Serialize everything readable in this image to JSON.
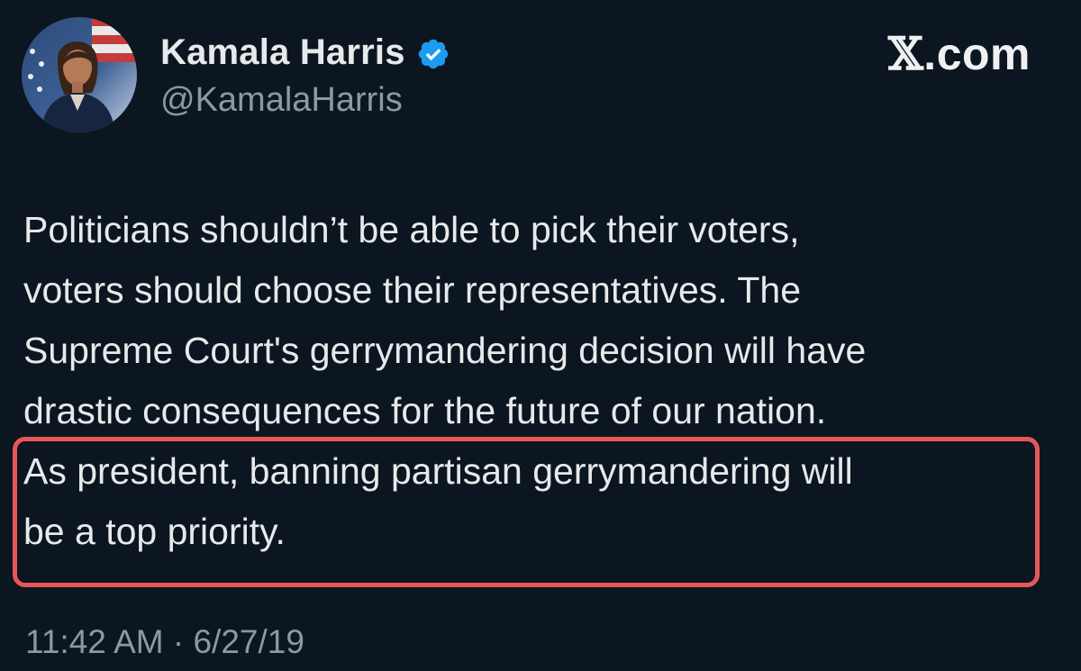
{
  "author": {
    "display_name": "Kamala Harris",
    "handle": "@KamalaHarris",
    "verified": true,
    "avatar_icon": "profile-photo"
  },
  "brand": {
    "x_glyph": "𝕏",
    "domain": ".com"
  },
  "tweet": {
    "text_before_highlight": "Politicians shouldn’t be able to pick their voters,\nvoters should choose their representatives. The\nSupreme Court's gerrymandering decision will have\ndrastic consequences for the future of our nation.",
    "highlighted_text": "As president, banning partisan gerrymandering will\nbe a top priority.",
    "timestamp": "11:42 AM · 6/27/19"
  },
  "colors": {
    "background": "#0c1620",
    "text": "#e7e9ea",
    "muted": "#8b98a5",
    "verified": "#1d9bf0",
    "highlight_border": "#e8565a"
  }
}
